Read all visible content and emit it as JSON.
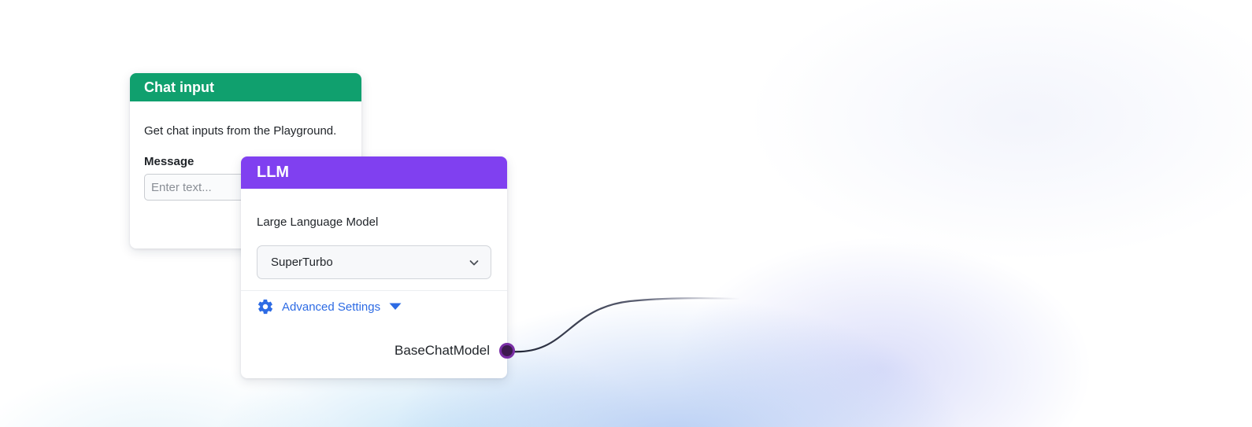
{
  "chat_input_node": {
    "title": "Chat input",
    "description": "Get chat inputs from the Playground.",
    "message_label": "Message",
    "message_placeholder": "Enter text...",
    "header_color": "#10a06e"
  },
  "llm_node": {
    "title": "LLM",
    "description": "Large Language Model",
    "model_select_value": "SuperTurbo",
    "advanced_settings_label": "Advanced Settings",
    "output_label": "BaseChatModel",
    "header_color": "#8040f0",
    "link_color": "#2d6be4",
    "handle_color": "#3d1a4f"
  },
  "icons": {
    "model_select": "chevron-down-icon",
    "advanced_settings": "gear-icon",
    "advanced_settings_toggle": "caret-down-icon"
  }
}
